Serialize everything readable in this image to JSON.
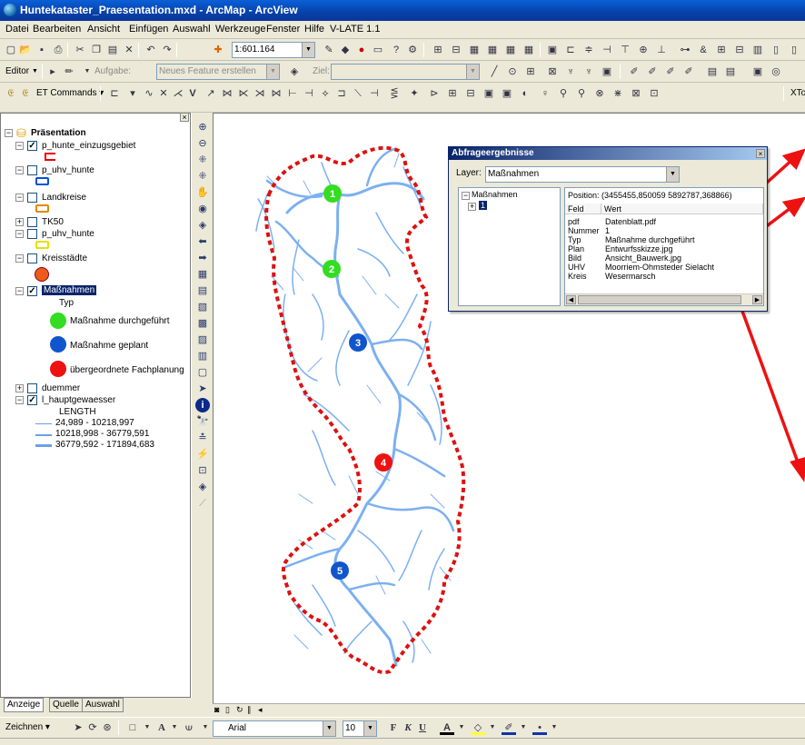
{
  "window": {
    "title": "Huntekataster_Praesentation.mxd - ArcMap - ArcView"
  },
  "menu": [
    "Datei",
    "Bearbeiten",
    "Ansicht",
    "Einfügen",
    "Auswahl",
    "Werkzeuge",
    "Fenster",
    "Hilfe",
    "V-LATE 1.1"
  ],
  "toolbar_standard": {
    "scale": "1:601.164"
  },
  "toolbar_editor": {
    "editor_label": "Editor",
    "task_label": "Aufgabe:",
    "task_value": "Neues Feature erstellen",
    "target_label": "Ziel:"
  },
  "toolbar_et": {
    "et_commands": "ET Commands",
    "xtools": "XTo"
  },
  "toc": {
    "root": "Präsentation",
    "layers": [
      {
        "name": "p_hunte_einzugsgebiet",
        "checked": true
      },
      {
        "name": "p_uhv_hunte",
        "checked": false
      },
      {
        "name": "Landkreise",
        "checked": false
      },
      {
        "name": "TK50",
        "checked": false
      },
      {
        "name": "p_uhv_hunte",
        "checked": false
      },
      {
        "name": "Kreisstädte",
        "checked": false
      },
      {
        "name": "Maßnahmen",
        "checked": true
      },
      {
        "name": "duemmer",
        "checked": false
      },
      {
        "name": "l_hauptgewaesser",
        "checked": true
      }
    ],
    "massnahmen_field": "Typ",
    "massnahmen_legend": [
      {
        "label": "Maßnahme durchgeführt",
        "color": "#33dd22"
      },
      {
        "label": "Maßnahme geplant",
        "color": "#1155cc"
      },
      {
        "label": "übergeordnete Fachplanung",
        "color": "#ee1111"
      }
    ],
    "gewaesser_field": "LENGTH",
    "gewaesser_legend": [
      "24,989 - 10218,997",
      "10218,998 - 36779,591",
      "36779,592 - 171894,683"
    ],
    "tabs": [
      "Anzeige",
      "Quelle",
      "Auswahl"
    ]
  },
  "map": {
    "points": [
      {
        "label": "1",
        "color": "#33dd22"
      },
      {
        "label": "2",
        "color": "#33dd22"
      },
      {
        "label": "3",
        "color": "#1155cc"
      },
      {
        "label": "4",
        "color": "#ee1111"
      },
      {
        "label": "5",
        "color": "#1155cc"
      }
    ]
  },
  "dialog": {
    "title": "Abfrageergebnisse",
    "layer_label": "Layer:",
    "layer_value": "Maßnahmen",
    "tree_root": "Maßnahmen",
    "tree_child": "1",
    "position": "Position: (3455455,850059 5892787,368866)",
    "col_field": "Feld",
    "col_value": "Wert",
    "rows": [
      {
        "field": "pdf",
        "value": "Datenblatt.pdf"
      },
      {
        "field": "Nummer",
        "value": "1"
      },
      {
        "field": "Typ",
        "value": "Maßnahme durchgeführt"
      },
      {
        "field": "Plan",
        "value": "Entwurfsskizze.jpg"
      },
      {
        "field": "Bild",
        "value": "Ansicht_Bauwerk.jpg"
      },
      {
        "field": "UHV",
        "value": "Moorriem-Ohmsteder Sielacht"
      },
      {
        "field": "Kreis",
        "value": "Wesermarsch"
      }
    ]
  },
  "drawbar": {
    "zeichnen": "Zeichnen",
    "font": "Arial",
    "size": "10",
    "bold": "F",
    "italic": "K",
    "underline": "U"
  }
}
